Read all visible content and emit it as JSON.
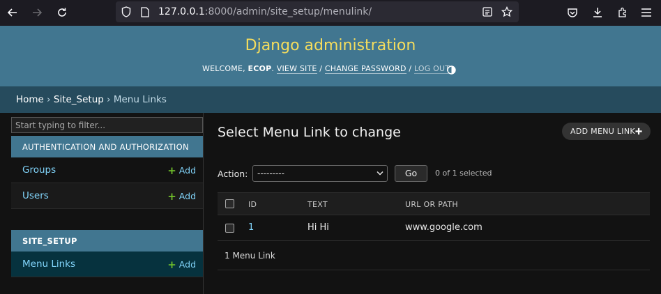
{
  "browser": {
    "url_host": "127.0.0.1",
    "url_rest": ":8000/admin/site_setup/menulink/"
  },
  "header": {
    "branding": "Django administration",
    "welcome": "WELCOME,",
    "username": "ECOP",
    "view_site": "VIEW SITE",
    "change_password": "CHANGE PASSWORD",
    "log_out": "LOG OUT",
    "sep": "/"
  },
  "breadcrumbs": {
    "home": "Home",
    "app": "Site_Setup",
    "current": "Menu Links",
    "sep": "›"
  },
  "sidebar": {
    "filter_placeholder": "Start typing to filter...",
    "modules": [
      {
        "caption": "AUTHENTICATION AND AUTHORIZATION",
        "models": [
          {
            "name": "Groups",
            "add": "Add"
          },
          {
            "name": "Users",
            "add": "Add"
          }
        ]
      },
      {
        "caption": "SITE_SETUP",
        "models": [
          {
            "name": "Menu Links",
            "add": "Add"
          }
        ]
      }
    ]
  },
  "main": {
    "title": "Select Menu Link to change",
    "add_button": "ADD MENU LINK",
    "action_label": "Action:",
    "action_selected": "---------",
    "go_button": "Go",
    "selected_count": "0 of 1 selected",
    "columns": [
      "ID",
      "TEXT",
      "URL OR PATH"
    ],
    "rows": [
      {
        "id": "1",
        "text": "Hi Hi",
        "url": "www.google.com"
      }
    ],
    "paginator": "1 Menu Link"
  },
  "colors": {
    "header_bg": "#417690",
    "branding": "#f5dd5d",
    "breadcrumbs_bg": "#264b5d",
    "link": "#81d4fa",
    "add_plus": "#70bf2b",
    "active_row_bg": "#06323e"
  },
  "icons": [
    "back-arrow-icon",
    "forward-arrow-icon",
    "reload-icon",
    "shield-icon",
    "page-icon",
    "reader-view-icon",
    "bookmark-star-icon",
    "pocket-icon",
    "download-icon",
    "extensions-icon",
    "menu-icon",
    "theme-toggle-icon",
    "plus-icon",
    "chevron-down-icon"
  ]
}
